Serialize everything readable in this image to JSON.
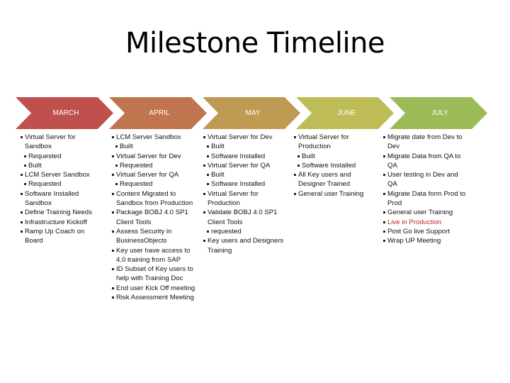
{
  "title": "Milestone Timeline",
  "phases": [
    {
      "label": "MARCH",
      "color": "#C0504D",
      "items": [
        {
          "text": "Virtual Server for Sandbox",
          "level": 1
        },
        {
          "text": "Requested",
          "level": 2
        },
        {
          "text": "Built",
          "level": 2
        },
        {
          "text": "LCM Server Sandbox",
          "level": 1
        },
        {
          "text": "Requested",
          "level": 2
        },
        {
          "text": "Software Installed Sandbox",
          "level": 1
        },
        {
          "text": "Define Training Needs",
          "level": 1
        },
        {
          "text": "Infrastructure Kickoff",
          "level": 1
        },
        {
          "text": "Ramp Up Coach on Board",
          "level": 1
        }
      ]
    },
    {
      "label": "APRIL",
      "color": "#C0754E",
      "items": [
        {
          "text": "LCM Server Sandbox",
          "level": 1
        },
        {
          "text": "Built",
          "level": 2
        },
        {
          "text": "Virtual Server for Dev",
          "level": 1
        },
        {
          "text": "Requested",
          "level": 2
        },
        {
          "text": "Virtual Server for QA",
          "level": 1
        },
        {
          "text": "Requested",
          "level": 2
        },
        {
          "text": "Content Migrated to Sandbox from Production",
          "level": 1
        },
        {
          "text": "Package BOBJ 4.0 SP1 Client Tools",
          "level": 1
        },
        {
          "text": "Assess Security in BusinessObjects",
          "level": 1
        },
        {
          "text": "Key user have access to 4.0 training from SAP",
          "level": 1
        },
        {
          "text": "ID Subset of Key users to help with Training Doc",
          "level": 1
        },
        {
          "text": "End user Kick Off meeting",
          "level": 1
        },
        {
          "text": "Risk Assessment Meeting",
          "level": 1
        }
      ]
    },
    {
      "label": "MAY",
      "color": "#BF9A52",
      "items": [
        {
          "text": "Virtual Server for Dev",
          "level": 1
        },
        {
          "text": "Built",
          "level": 2
        },
        {
          "text": "Software Installed",
          "level": 2
        },
        {
          "text": "Virtual Server for  QA",
          "level": 1
        },
        {
          "text": "Built",
          "level": 2
        },
        {
          "text": "Software Installed",
          "level": 2
        },
        {
          "text": "Virtual Server for Production",
          "level": 1
        },
        {
          "text": "Validate BOBJ 4.0 SP1 Client Tools",
          "level": 1
        },
        {
          "text": "requested",
          "level": 2
        },
        {
          "text": "Key users and Designers Training",
          "level": 1
        }
      ]
    },
    {
      "label": "JUNE",
      "color": "#BEBC57",
      "items": [
        {
          "text": "Virtual Server for Production",
          "level": 1
        },
        {
          "text": "Built",
          "level": 2
        },
        {
          "text": "Software Installed",
          "level": 2
        },
        {
          "text": "All Key users and Designer Trained",
          "level": 1
        },
        {
          "text": "General user Training",
          "level": 1
        }
      ]
    },
    {
      "label": "JULY",
      "color": "#9BBB59",
      "items": [
        {
          "text": "Migrate date from Dev to Dev",
          "level": 1
        },
        {
          "text": "Migrate Data from QA to QA",
          "level": 1
        },
        {
          "text": "User testing in Dev and QA",
          "level": 1
        },
        {
          "text": "Migrate Data form Prod to Prod",
          "level": 1
        },
        {
          "text": "General user Training",
          "level": 1
        },
        {
          "text": "Live in Production",
          "level": 1,
          "highlight": true,
          "highlight_color": "#C0272D"
        },
        {
          "text": "Post Go live Support",
          "level": 1
        },
        {
          "text": "Wrap  UP Meeting",
          "level": 1
        }
      ]
    }
  ]
}
